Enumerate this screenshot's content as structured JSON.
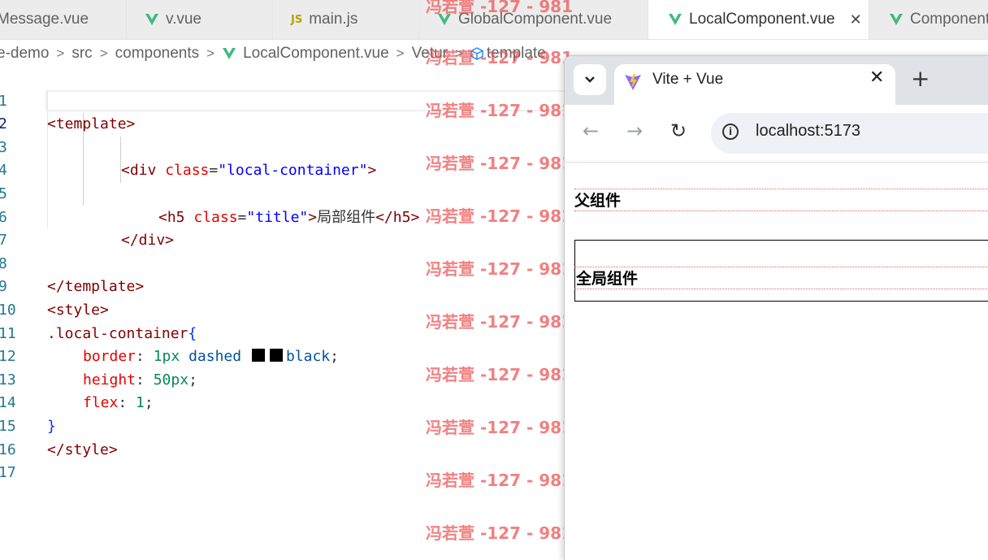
{
  "editor": {
    "tabs": [
      {
        "label": "Message.vue",
        "icon": "vue-icon"
      },
      {
        "label": "v.vue",
        "icon": "vue-icon"
      },
      {
        "label": "main.js",
        "icon": "js-icon",
        "badge": "JS"
      },
      {
        "label": "GlobalComponent.vue",
        "icon": "vue-icon"
      },
      {
        "label": "LocalComponent.vue",
        "icon": "vue-icon",
        "active": true,
        "close": "✕"
      },
      {
        "label": "Component",
        "icon": "vue-icon"
      }
    ],
    "breadcrumb": [
      "e-demo",
      "src",
      "components",
      "LocalComponent.vue",
      "Vetur",
      "template"
    ],
    "breadcrumb_sep": ">",
    "line_numbers": [
      "1",
      "2",
      "3",
      "4",
      "5",
      "6",
      "7",
      "8",
      "9",
      "10",
      "11",
      "12",
      "13",
      "14",
      "15",
      "16",
      "17"
    ],
    "current_line": "2"
  },
  "code": {
    "l1": "<template>",
    "l3a": "<div ",
    "l3b": "class",
    "l3c": "=",
    "l3d": "\"local-container\"",
    "l3e": ">",
    "l5a": "<h5 ",
    "l5b": "class",
    "l5c": "=",
    "l5d": "\"title\"",
    "l5e": ">",
    "l5f": "局部组件",
    "l5g": "</h5>",
    "l6": "</div>",
    "l8": "</template>",
    "l9": "<style>",
    "l10a": ".local-container",
    "l10b": "{",
    "l11a": "border",
    "l11b": ": ",
    "l11c": "1px",
    "l11d": " dashed ",
    "l11e": "black",
    "l11f": ";",
    "l12a": "height",
    "l12b": ": ",
    "l12c": "50px",
    "l12d": ";",
    "l13a": "flex",
    "l13b": ": ",
    "l13c": "1",
    "l13d": ";",
    "l14": "}",
    "l15": "</style>"
  },
  "watermark": {
    "text": "冯若萱 -127 - 981",
    "color": "#eb5050"
  },
  "browser": {
    "tab_title": "Vite + Vue",
    "tab_close": "✕",
    "new_tab": "+",
    "dropdown": "⌄",
    "back": "←",
    "forward": "→",
    "reload": "↻",
    "info": "i",
    "url": "localhost:5173",
    "page": {
      "parent_heading": "父组件",
      "global_heading": "全局组件"
    }
  }
}
